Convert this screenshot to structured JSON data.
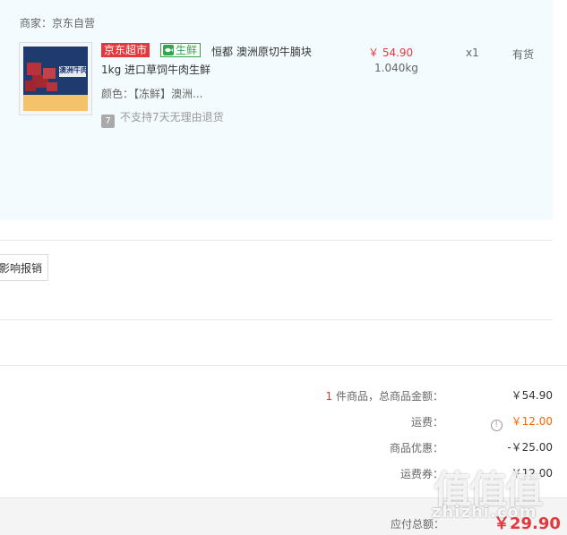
{
  "seller": {
    "label": "商家：京东自营"
  },
  "product": {
    "badge_supermarket": "京东超市",
    "badge_fresh": "生鲜",
    "title_line1": "恒都 澳洲原切牛腩块",
    "title_line2": "1kg 进口草饲牛肉生鲜",
    "color_label": "颜色：【冻鲜】澳洲...",
    "return_policy": "不支持7天无理由退货",
    "return_icon_text": "7",
    "price": "￥ 54.90",
    "weight": "1.040kg",
    "quantity": "x1",
    "stock": "有货",
    "image_caption": "澳洲牛肉"
  },
  "invoice": {
    "report_button": "影响报销"
  },
  "summary": {
    "items_count": "1",
    "items_label": "件商品，总商品金额：",
    "items_value": "￥54.90",
    "shipping_label": "运费：",
    "shipping_value": "￥12.00",
    "discount_label": "商品优惠：",
    "discount_value": "-￥25.00",
    "coupon_label": "运费券：",
    "coupon_value": "￥12.00",
    "total_label": "应付总额：",
    "total_value": "￥29.90"
  },
  "watermark": {
    "glyphs": "值值值",
    "site": "zhizhi.com"
  },
  "colors": {
    "accent_red": "#e4393c",
    "fresh_green": "#37a34a",
    "panel_bg": "#f3fbfe"
  }
}
